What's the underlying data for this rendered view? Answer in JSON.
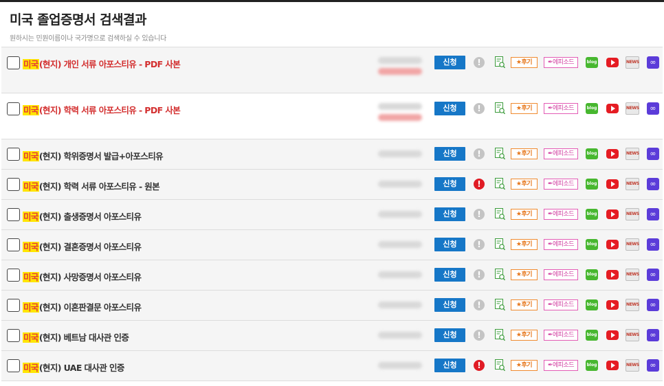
{
  "page": {
    "title": "미국 졸업증명서 검색결과",
    "subtitle": "원하시는 민원이름이나 국가명으로 검색하실 수 있습니다"
  },
  "actions": {
    "apply_label": "신청",
    "warn_icon": "!",
    "review_label": "★후기",
    "episode_label": "✒에피소드",
    "blog_label": "blog",
    "news_label": "NEWS",
    "link_icon": "∞",
    "icons": [
      "info-icon",
      "document-search-icon",
      "youtube-icon",
      "news-icon",
      "link-icon"
    ]
  },
  "colors": {
    "accent": "#1677c7",
    "highlight_bg": "#ffe500",
    "highlight_text": "#e53935",
    "warn_active": "#e01b24"
  },
  "items": [
    {
      "country": "미국",
      "name": "(현지) 개인 서류 아포스티유 - PDF 사본",
      "style": "red",
      "size": "tall",
      "warning": false
    },
    {
      "country": "미국",
      "name": "(현지) 학력 서류 아포스티유 - PDF 사본",
      "style": "red",
      "size": "tall",
      "warning": false
    },
    {
      "country": "미국",
      "name": "(현지) 학위증명서 발급+아포스티유",
      "style": "dark",
      "size": "short",
      "warning": false
    },
    {
      "country": "미국",
      "name": "(현지) 학력 서류 아포스티유 - 원본",
      "style": "dark",
      "size": "short",
      "warning": true
    },
    {
      "country": "미국",
      "name": "(현지) 출생증명서 아포스티유",
      "style": "dark",
      "size": "short",
      "warning": false
    },
    {
      "country": "미국",
      "name": "(현지) 결혼증명서 아포스티유",
      "style": "dark",
      "size": "short",
      "warning": false
    },
    {
      "country": "미국",
      "name": "(현지) 사망증명서 아포스티유",
      "style": "dark",
      "size": "short",
      "warning": false
    },
    {
      "country": "미국",
      "name": "(현지) 이혼판결문 아포스티유",
      "style": "dark",
      "size": "short",
      "warning": false
    },
    {
      "country": "미국",
      "name": "(현지) 베트남 대사관 인증",
      "style": "dark",
      "size": "short",
      "warning": false
    },
    {
      "country": "미국",
      "name": "(현지) UAE 대사관 인증",
      "style": "dark",
      "size": "short",
      "warning": true
    }
  ]
}
